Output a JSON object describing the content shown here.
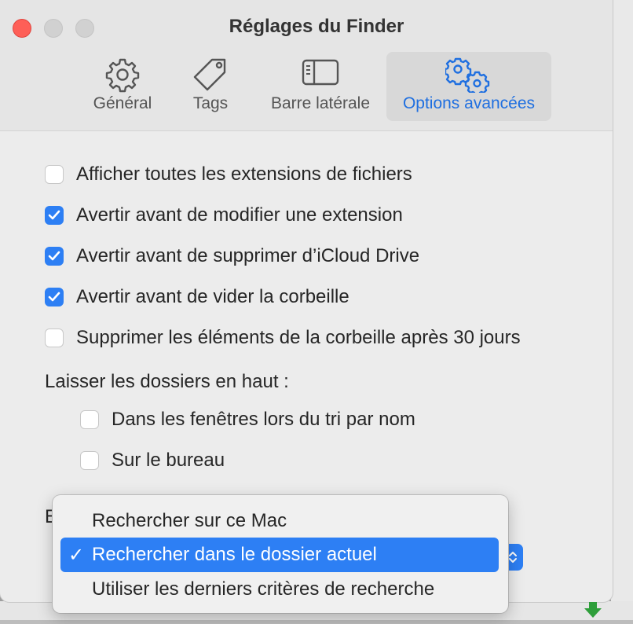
{
  "window": {
    "title": "Réglages du Finder"
  },
  "tabs": [
    {
      "label": "Général",
      "icon": "gear-icon"
    },
    {
      "label": "Tags",
      "icon": "tag-icon"
    },
    {
      "label": "Barre latérale",
      "icon": "sidebar-icon"
    },
    {
      "label": "Options avancées",
      "icon": "gears-icon",
      "selected": true
    }
  ],
  "options": [
    {
      "label": "Afficher toutes les extensions de fichiers",
      "checked": false
    },
    {
      "label": "Avertir avant de modifier une extension",
      "checked": true
    },
    {
      "label": "Avertir avant de supprimer d’iCloud Drive",
      "checked": true
    },
    {
      "label": "Avertir avant de vider la corbeille",
      "checked": true
    },
    {
      "label": "Supprimer les éléments de la corbeille après 30 jours",
      "checked": false
    }
  ],
  "folders_on_top": {
    "label": "Laisser les dossiers en haut :",
    "items": [
      {
        "label": "Dans les fenêtres lors du tri par nom",
        "checked": false
      },
      {
        "label": "Sur le bureau",
        "checked": false
      }
    ]
  },
  "search_label_partial": "E",
  "search_menu": {
    "items": [
      {
        "label": "Rechercher sur ce Mac",
        "selected": false
      },
      {
        "label": "Rechercher dans le dossier actuel",
        "selected": true,
        "check": "✓"
      },
      {
        "label": "Utiliser les derniers critères de recherche",
        "selected": false
      }
    ]
  },
  "colors": {
    "accent": "#2d7ff4",
    "close": "#fe5f57",
    "selected_tab_text": "#1f6fe0"
  }
}
